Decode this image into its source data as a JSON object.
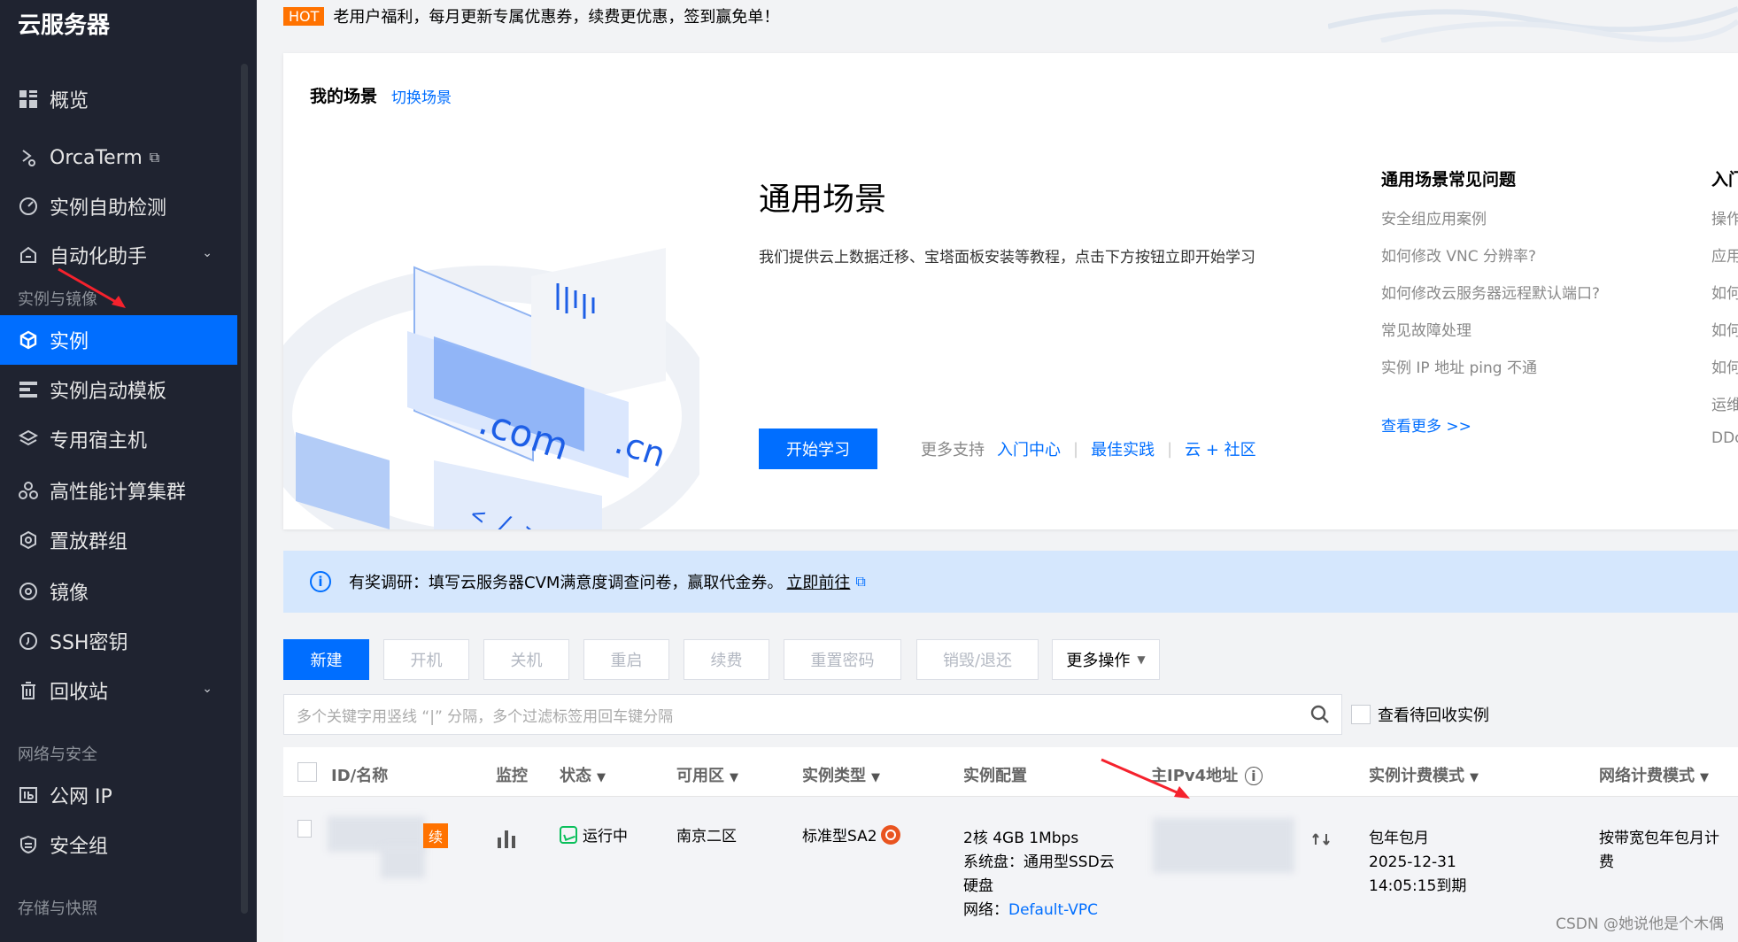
{
  "sidebar": {
    "title": "云服务器",
    "items": [
      {
        "label": "概览"
      },
      {
        "label": "OrcaTerm"
      },
      {
        "label": "实例自助检测"
      },
      {
        "label": "自动化助手"
      },
      {
        "label": "实例"
      },
      {
        "label": "实例启动模板"
      },
      {
        "label": "专用宿主机"
      },
      {
        "label": "高性能计算集群"
      },
      {
        "label": "置放群组"
      },
      {
        "label": "镜像"
      },
      {
        "label": "SSH密钥"
      },
      {
        "label": "回收站"
      },
      {
        "label": "公网 IP"
      },
      {
        "label": "安全组"
      }
    ],
    "sections": {
      "instances": "实例与镜像",
      "network": "网络与安全",
      "storage": "存储与快照"
    }
  },
  "hot": {
    "badge": "HOT",
    "text": "老用户福利，每月更新专属优惠券，续费更优惠，签到赢免单！"
  },
  "scene": {
    "header": "我的场景",
    "switch": "切换场景",
    "title": "通用场景",
    "desc": "我们提供云上数据迁移、宝塔面板安装等教程，点击下方按钮立即开始学习",
    "start_button": "开始学习",
    "more_support": "更多支持",
    "links": [
      "入门中心",
      "最佳实践",
      "云 + 社区"
    ],
    "faq_title": "通用场景常见问题",
    "faq_items": [
      "安全组应用案例",
      "如何修改 VNC 分辨率?",
      "如何修改云服务器远程默认端口?",
      "常见故障处理",
      "实例 IP 地址 ping 不通"
    ],
    "faq_more": "查看更多 >>",
    "faq2_title": "入门",
    "faq2_items": [
      "操作",
      "应用",
      "如何",
      "如何",
      "如何",
      "运维",
      "DDo"
    ]
  },
  "survey": {
    "text": "有奖调研：填写云服务器CVM满意度调查问卷，赢取代金券。",
    "link": "立即前往"
  },
  "toolbar": {
    "new": "新建",
    "start": "开机",
    "stop": "关机",
    "restart": "重启",
    "renew": "续费",
    "reset_pwd": "重置密码",
    "destroy": "销毁/退还",
    "more": "更多操作"
  },
  "search": {
    "placeholder": "多个关键字用竖线 “|” 分隔，多个过滤标签用回车键分隔",
    "recycle_label": "查看待回收实例"
  },
  "table": {
    "headers": [
      "ID/名称",
      "监控",
      "状态",
      "可用区",
      "实例类型",
      "实例配置",
      "主IPv4地址",
      "实例计费模式",
      "网络计费模式"
    ],
    "row": {
      "renew_tag": "续",
      "status": "运行中",
      "zone": "南京二区",
      "type": "标准型SA2",
      "config_line1": "2核 4GB 1Mbps",
      "config_line2": "系统盘：通用型SSD云",
      "config_line3": "硬盘",
      "network_label": "网络：",
      "network_value": "Default-VPC",
      "billing_line1": "包年包月",
      "billing_line2": "2025-12-31",
      "billing_line3": "14:05:15到期",
      "net_billing_line1": "按带宽包年包月计",
      "net_billing_line2": "费"
    }
  },
  "watermark": "CSDN @她说他是个木偶",
  "colors": {
    "accent": "#006eff",
    "sidebar": "#1f2330",
    "hot": "#ff7200",
    "running": "#0abf5b"
  }
}
